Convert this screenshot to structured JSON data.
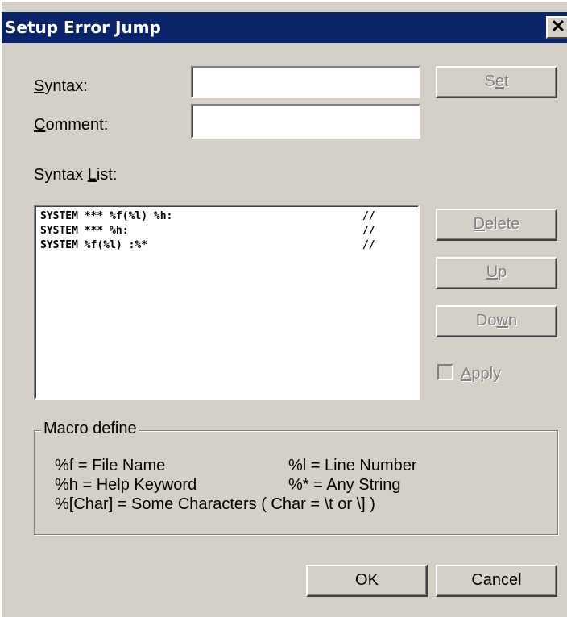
{
  "window": {
    "title": "Setup Error Jump",
    "close_glyph": "✕"
  },
  "form": {
    "syntax_label_u": "S",
    "syntax_label_rest": "yntax:",
    "syntax_value": "",
    "comment_label_u": "C",
    "comment_label_rest": "omment:",
    "comment_value": "",
    "set_pre": "S",
    "set_u": "e",
    "set_post": "t"
  },
  "syntax_list": {
    "label_pre": "Syntax ",
    "label_u": "L",
    "label_post": "ist:",
    "items": [
      {
        "syntax": "SYSTEM *** %f(%l) %h:",
        "comment": "//"
      },
      {
        "syntax": "SYSTEM *** %h:",
        "comment": "//"
      },
      {
        "syntax": "SYSTEM %f(%l) :%*",
        "comment": "//"
      }
    ]
  },
  "buttons": {
    "delete_u": "D",
    "delete_rest": "elete",
    "up_u": "U",
    "up_rest": "p",
    "down_pre": "Do",
    "down_u": "w",
    "down_post": "n",
    "apply_u": "A",
    "apply_rest": "pply",
    "apply_checked": false,
    "ok": "OK",
    "cancel": "Cancel"
  },
  "macro": {
    "title": "Macro define",
    "file_name": "%f = File Name",
    "line_number": "%l = Line Number",
    "help_keyword": "%h = Help Keyword",
    "any_string": "%* = Any String",
    "chars": "%[Char] = Some Characters ( Char = \\t or \\] )"
  }
}
